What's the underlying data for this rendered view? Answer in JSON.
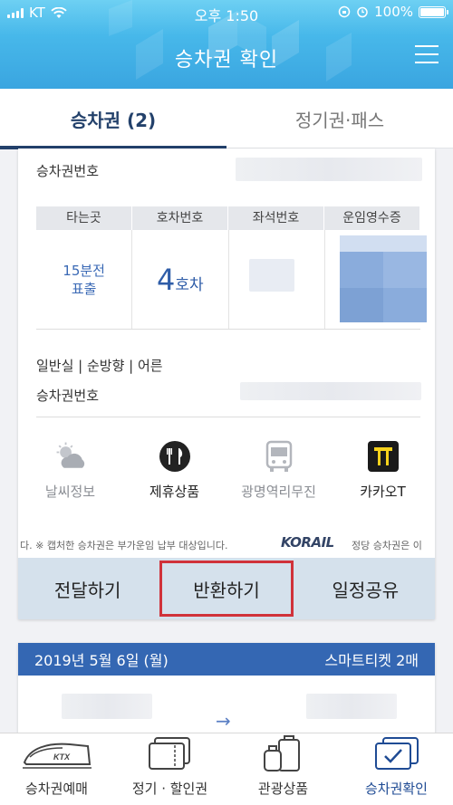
{
  "status_bar": {
    "carrier": "KT",
    "time": "오후 1:50",
    "battery": "100%"
  },
  "header": {
    "title": "승차권 확인"
  },
  "tabs": [
    {
      "label": "승차권 (2)"
    },
    {
      "label": "정기권·패스"
    }
  ],
  "ticket": {
    "number_label": "승차권번호",
    "columns": [
      "타는곳",
      "호차번호",
      "좌석번호",
      "운임영수증"
    ],
    "departure_line1": "15분전",
    "departure_line2": "표출",
    "car_number": "4",
    "car_suffix": "호차",
    "seat_info": "일반실 | 순방향 | 어른",
    "number_label2": "승차권번호"
  },
  "services": [
    {
      "label": "날씨정보",
      "icon": "weather-icon"
    },
    {
      "label": "제휴상품",
      "icon": "dining-icon"
    },
    {
      "label": "광명역리무진",
      "icon": "bus-icon"
    },
    {
      "label": "카카오T",
      "icon": "kakao-t-icon"
    }
  ],
  "notice": {
    "text_left": "다. ※ 캡처한 승차권은 부가운임 납부 대상입니다.",
    "logo": "KORAIL",
    "text_right": "정당 승차권은 이"
  },
  "actions": [
    {
      "label": "전달하기"
    },
    {
      "label": "반환하기"
    },
    {
      "label": "일정공유"
    }
  ],
  "ticket2": {
    "date": "2019년 5월 6일 (월)",
    "type": "스마트티켓 2매",
    "arrow": "→"
  },
  "bottom_nav": [
    {
      "label": "승차권예매",
      "icon": "ktx-train-icon"
    },
    {
      "label": "정기 · 할인권",
      "icon": "discount-ticket-icon"
    },
    {
      "label": "관광상품",
      "icon": "luggage-icon"
    },
    {
      "label": "승차권확인",
      "icon": "ticket-check-icon"
    }
  ],
  "colors": {
    "accent": "#23416b",
    "highlight": "#d0323a",
    "action_bar": "#d5e1ec"
  }
}
